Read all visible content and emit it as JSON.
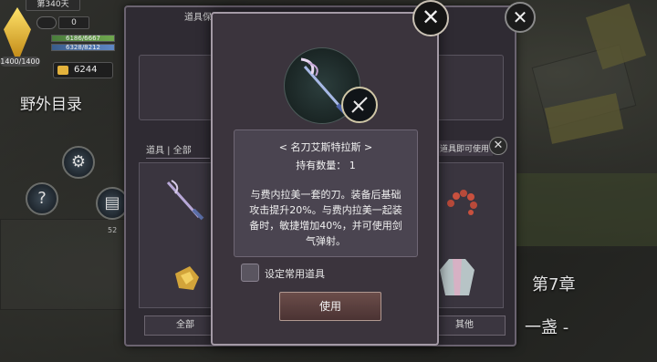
{
  "hud": {
    "days": "第340天",
    "resource_count": "0",
    "hp": "1400/1400",
    "stat_bar_1": "6186/6667",
    "stat_bar_2": "6328/8212",
    "gold": "6244",
    "field_title": "野外目录",
    "side_number": "52"
  },
  "storage": {
    "title": "道具保管箱",
    "tab_label": "道具 | 全部",
    "tip": "道具即可使用",
    "btn_all": "全部",
    "btn_other": "其他"
  },
  "popup": {
    "item_name": "< 名刀艾斯特拉斯 >",
    "item_count": "持有数量： 1",
    "description": "与费内拉美一套的刀。装备后基础攻击提升20%。与费内拉美一起装备时，敏捷增加40%，并可使用剑气弹射。",
    "favorite_label": "设定常用道具",
    "use_label": "使用"
  },
  "scene": {
    "chapter": "第7章",
    "lamp": "一盏 -"
  },
  "icons": {
    "close": "close-icon",
    "gear": "gear-icon",
    "help": "help-icon",
    "bag": "bag-icon",
    "coin": "coin-icon",
    "sword": "sword-icon",
    "crystal": "crystal-icon"
  },
  "colors": {
    "popup_bg": "#3b343d",
    "popup_border": "#a49aa6",
    "use_button": "#6b4d4a",
    "crystal": "#ffe36a"
  }
}
